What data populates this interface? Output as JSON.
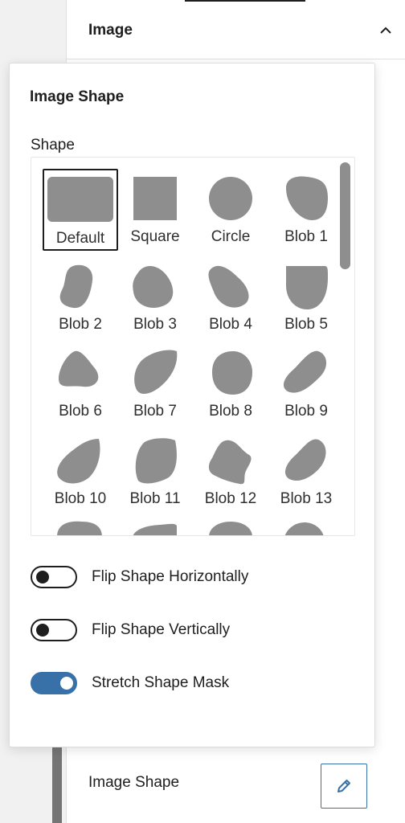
{
  "sidebar": {
    "panel_title": "Image",
    "bottom_row_title": "Image Shape"
  },
  "popover": {
    "title": "Image Shape",
    "shape_label": "Shape",
    "selected_shape": "Default",
    "shapes": [
      "Default",
      "Square",
      "Circle",
      "Blob 1",
      "Blob 2",
      "Blob 3",
      "Blob 4",
      "Blob 5",
      "Blob 6",
      "Blob 7",
      "Blob 8",
      "Blob 9",
      "Blob 10",
      "Blob 11",
      "Blob 12",
      "Blob 13"
    ],
    "toggles": [
      {
        "label": "Flip Shape Horizontally",
        "checked": false
      },
      {
        "label": "Flip Shape Vertically",
        "checked": false
      },
      {
        "label": "Stretch Shape Mask",
        "checked": true
      }
    ]
  },
  "colors": {
    "shape_fill": "#8e8e8e",
    "accent": "#3871a8",
    "text": "#1e1e1e"
  },
  "icons": [
    "chevron-up-icon",
    "pencil-icon"
  ]
}
